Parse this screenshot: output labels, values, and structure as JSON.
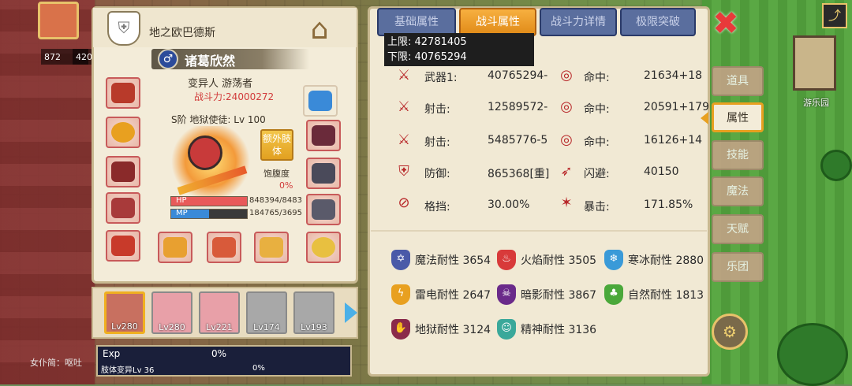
{
  "hud": {
    "stat1": "872",
    "stat2": "420"
  },
  "panel": {
    "title": "地之欧巴德斯",
    "name": "诸葛欣然",
    "class_line": "变异人 游荡者",
    "power": "战斗力:24000272",
    "rank": "S阶 地狱使徒: Lv 100",
    "extra_button": "额外肢体",
    "satiety_label": "饱腹度",
    "satiety_value": "0%",
    "hp_label": "HP",
    "hp_value": "848394/8483",
    "hp_fraction": 1.0,
    "mp_label": "MP",
    "mp_value": "184765/3695",
    "mp_fraction": 0.5
  },
  "roster": [
    {
      "level": "Lv280",
      "selected": true
    },
    {
      "level": "Lv280",
      "selected": false
    },
    {
      "level": "Lv221",
      "selected": false
    },
    {
      "level": "Lv174",
      "selected": false
    },
    {
      "level": "Lv193",
      "selected": false
    }
  ],
  "exp": {
    "label": "Exp",
    "value": "0%",
    "sub_label": "肢体变异Lv 36",
    "sub_value": "0%"
  },
  "chat": {
    "text": "女仆简：呕吐"
  },
  "tabs": [
    {
      "label": "基础属性",
      "active": false
    },
    {
      "label": "战斗属性",
      "active": true
    },
    {
      "label": "战斗力详情",
      "active": false
    },
    {
      "label": "极限突破",
      "active": false
    }
  ],
  "tooltip": {
    "upper": "上限: 42781405",
    "lower": "下限: 40765294"
  },
  "stats": [
    {
      "left_label": "武器1:",
      "left_value": "40765294-",
      "right_label": "命中:",
      "right_value": "21634+18"
    },
    {
      "left_label": "射击:",
      "left_value": "12589572-",
      "right_label": "命中:",
      "right_value": "20591+179"
    },
    {
      "left_label": "射击:",
      "left_value": "5485776-5",
      "right_label": "命中:",
      "right_value": "16126+14"
    },
    {
      "left_label": "防御:",
      "left_value": "865368[重]",
      "right_label": "闪避:",
      "right_value": "40150"
    },
    {
      "left_label": "格挡:",
      "left_value": "30.00%",
      "right_label": "暴击:",
      "right_value": "171.85%"
    }
  ],
  "resistances": [
    {
      "text": "魔法耐性 3654",
      "color": "#4a5aa8"
    },
    {
      "text": "火焰耐性 3505",
      "color": "#d83a3a"
    },
    {
      "text": "寒冰耐性 2880",
      "color": "#3a9ad8"
    },
    {
      "text": "雷电耐性 2647",
      "color": "#e8a020"
    },
    {
      "text": "暗影耐性 3867",
      "color": "#6a2a8a"
    },
    {
      "text": "自然耐性 1813",
      "color": "#4aa83a"
    },
    {
      "text": "地狱耐性 3124",
      "color": "#8a2a4a"
    },
    {
      "text": "精神耐性 3136",
      "color": "#3aa89a"
    }
  ],
  "side_tabs": [
    {
      "label": "道具",
      "active": false
    },
    {
      "label": "属性",
      "active": true
    },
    {
      "label": "技能",
      "active": false
    },
    {
      "label": "魔法",
      "active": false
    },
    {
      "label": "天赋",
      "active": false
    },
    {
      "label": "乐团",
      "active": false
    }
  ],
  "map_label": "游乐园",
  "colors": {
    "accent": "#e8a020",
    "power": "#d13a3a",
    "hp": "#e85a5a",
    "mp": "#3a8ad8"
  }
}
